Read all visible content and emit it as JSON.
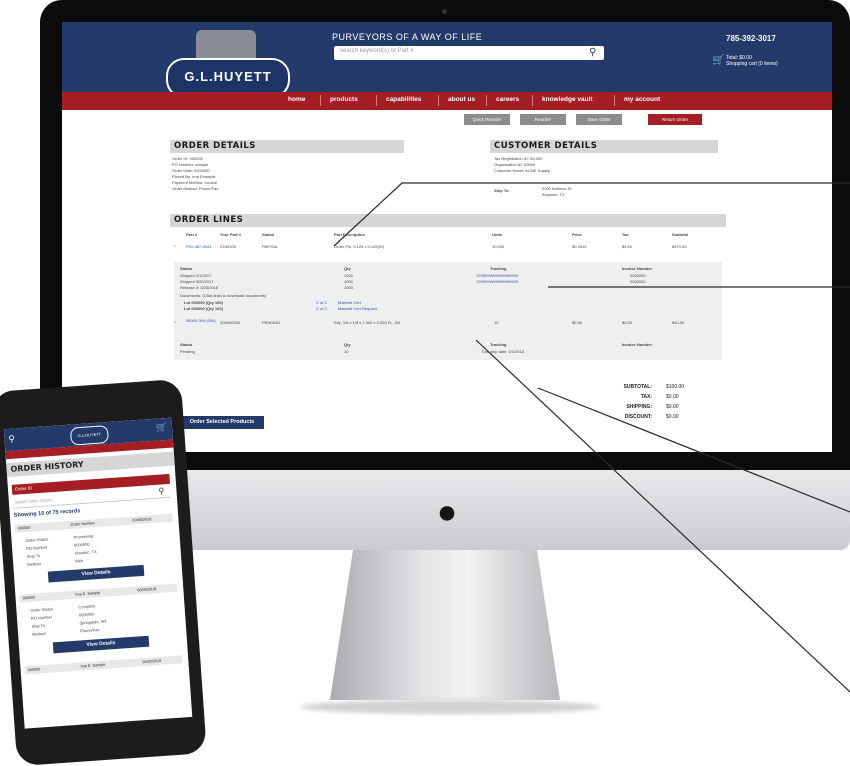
{
  "site": {
    "logo_text": "G.L.HUYETT",
    "tagline": "PURVEYORS OF A WAY OF LIFE",
    "search_placeholder": "search keyword(s) or Part #",
    "phone": "785-392-3017",
    "cart_line1": "Total: $0.00",
    "cart_line2": "Shopping cart (0 items)",
    "nav": [
      "home",
      "products",
      "capabilities",
      "about us",
      "careers",
      "knowledge vault",
      "my account"
    ],
    "sub_buttons": [
      "Quick Reorder",
      "Reorder",
      "Save Order"
    ],
    "return_button": "Return Order"
  },
  "order_details": {
    "title": "ORDER DETAILS",
    "lines": [
      "Order ID: 000000",
      "PO Number: sample",
      "Order Date: 00/00/00",
      "Placed By: Ima Example",
      "Payment Method: Invoice",
      "Order Method: Phone/Fax"
    ]
  },
  "customer_details": {
    "title": "CUSTOMER DETAILS",
    "lines": [
      "Tax Registration ID: 00-000",
      "Organization ID: 00000",
      "Customer Name: ACME Supply"
    ],
    "ship_to_label": "Ship To:",
    "ship_to_lines": [
      "0000 Address St",
      "Anytown, TX"
    ]
  },
  "order_lines": {
    "title": "ORDER LINES",
    "headers": [
      "Part #",
      "Your Part #",
      "Status",
      "Part Description",
      "Units",
      "Price",
      "Tax",
      "Subtotal"
    ],
    "row1": [
      "P01-987-6543",
      "ZZ40100",
      "PARTIAL",
      "Order Pin, 0.125 x 0.125(ID)",
      "10,000",
      "$0.4510",
      "$4.00",
      "$970.00"
    ],
    "detail1_headers": [
      "Status",
      "Qty",
      "Tracking",
      "Invoice Number"
    ],
    "detail1_lines": [
      "Shipped 3/1/2017",
      "Shipped 3/20/2017",
      "Release 3: 3/23/2018"
    ],
    "detail1_qty": [
      "1000",
      "1000",
      "1000"
    ],
    "detail1_tracking": [
      "1Z9999W99999999999",
      "1Z9999W99999999999"
    ],
    "detail1_invoice": [
      "0000000",
      "0000000"
    ],
    "docs_label": "Documents: (Click links to download documents)",
    "lot1": "Lot 000000 (Qty 100)",
    "lot2": "Lot 000000 (Qty 100)",
    "lot1_link": "Material Cert",
    "lot2_link": "Material Cert Request",
    "lot_prefix": "C of C",
    "row2": [
      "05000-000 (000)",
      "Z00000000",
      "PENDING",
      "Key, 1/8 x 1/8 x 1.000 x 0.003 FL, ZN",
      "10",
      "$0.40",
      "$0.00",
      "$40.00"
    ],
    "detail2_headers": [
      "Status",
      "Qty",
      "Tracking",
      "Invoice Number"
    ],
    "detail2": [
      "Pending",
      "10",
      "Est. ship date: 3/1/2018",
      ""
    ]
  },
  "summary": {
    "labels": [
      "SUBTOTAL:",
      "TAX:",
      "SHIPPING:",
      "DISCOUNT:"
    ],
    "values": [
      "$100.00",
      "$0.00",
      "$0.00",
      "$0.00"
    ]
  },
  "order_selected_button": "Order Selected Products",
  "mobile": {
    "title": "ORDER HISTORY",
    "select_value": "Order ID",
    "search_placeholder": "Search Order History",
    "showing": "Showing 10 of 75 records",
    "cards": [
      {
        "head_left": "000000",
        "head_mid": "Order Number",
        "head_right": "00/00/2018",
        "rows": [
          [
            "Order Status",
            "Processing"
          ],
          [
            "PO Number",
            "0000000"
          ],
          [
            "Ship To",
            "Houston, TX"
          ],
          [
            "Method",
            "Web"
          ]
        ],
        "button": "View Details"
      },
      {
        "head_left": "000000",
        "head_mid": "Ima E. Sample",
        "head_right": "00/00/2018",
        "rows": [
          [
            "Order Status",
            "Complete"
          ],
          [
            "PO Number",
            "0000000"
          ],
          [
            "Ship To",
            "Springdale, AR"
          ],
          [
            "Method",
            "Phone/Fax"
          ]
        ],
        "button": "View Details"
      },
      {
        "head_left": "000000",
        "head_mid": "Ima E. Sample",
        "head_right": "00/00/2018"
      }
    ]
  }
}
